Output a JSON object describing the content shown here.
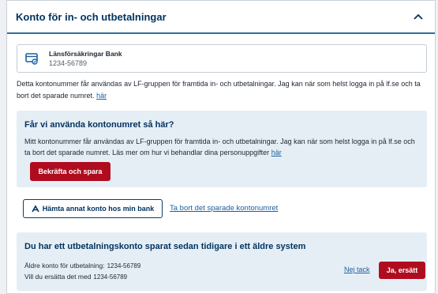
{
  "panel": {
    "title": "Konto för in- och utbetalningar",
    "collapse_icon": "chevron-up-icon"
  },
  "account": {
    "icon": "bank-card-icon",
    "bank_name": "Länsförsäkringar Bank",
    "number": "1234-56789"
  },
  "intro": {
    "text": "Detta kontonummer får användas av LF-gruppen för framtida in- och utbetalningar. Jag kan när som helst logga in på lf.se och ta bort det sparade numret.",
    "link": "här"
  },
  "consent": {
    "title": "Får vi använda kontonumret så här?",
    "text": "Mitt kontonummer får användas av LF-gruppen för framtida in- och utbetalningar. Jag kan när som helst logga in på lf.se och ta bort det sparade numret. Läs mer om hur vi behandlar dina personuppgifter",
    "link": "här",
    "confirm_label": "Bekräfta och spara"
  },
  "actions": {
    "fetch_label": "Hämta annat konto hos min bank",
    "fetch_icon": "bank-link-icon",
    "remove_label": "Ta bort det sparade kontonumret"
  },
  "old_account": {
    "title": "Du har ett utbetalningskonto sparat sedan tidigare i ett äldre system",
    "line1_label": "Äldre konto för utbetalning:",
    "line1_value": "1234-56789",
    "line2_label": "Vill du ersätta det med",
    "line2_value": "1234-56789",
    "decline_label": "Nej tack",
    "accept_label": "Ja, ersätt"
  },
  "colors": {
    "brand_dark": "#00325f",
    "accent_red": "#b00c1f",
    "link": "#1b5fa0",
    "box_bg": "#e6eef5"
  }
}
